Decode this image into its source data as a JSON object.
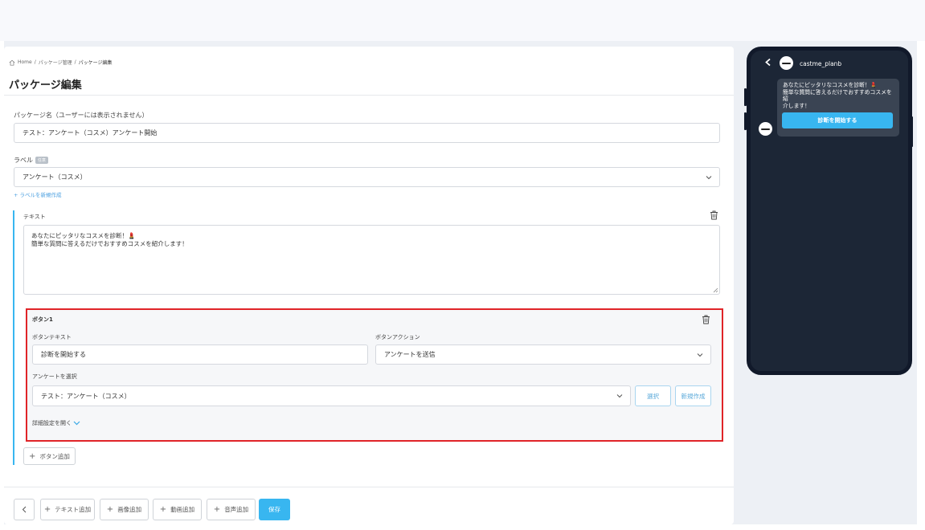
{
  "breadcrumb": {
    "home": "Home",
    "sep1": "/",
    "item1": "パッケージ管理",
    "sep2": "/",
    "item2": "パッケージ編集"
  },
  "page_title": "パッケージ編集",
  "package_name": {
    "label": "パッケージ名（ユーザーには表示されません）",
    "value": "テスト：アンケート（コスメ）アンケート開始"
  },
  "label_field": {
    "label": "ラベル",
    "badge": "任意",
    "value": "アンケート（コスメ）",
    "create_link": "+ ラベルを新規作成"
  },
  "text_block": {
    "title": "テキスト",
    "line1": "あなたにピッタリなコスメを診断！",
    "line1_emoji": "💄",
    "line2": "簡単な質問に答えるだけでおすすめコスメを紹介します！"
  },
  "button_card": {
    "title": "ボタン1",
    "button_text_label": "ボタンテキスト",
    "button_text_value": "診断を開始する",
    "button_action_label": "ボタンアクション",
    "button_action_value": "アンケートを送信",
    "survey_label": "アンケートを選択",
    "survey_value": "テスト：アンケート（コスメ）",
    "select_button": "選択",
    "new_button": "新規作成",
    "details_link": "詳細設定を開く"
  },
  "add_button": "ボタン追加",
  "footer": {
    "back": "<",
    "add_text": "テキスト追加",
    "add_image": "画像追加",
    "add_video": "動画追加",
    "add_audio": "音声追加",
    "save": "保存"
  },
  "preview": {
    "account_name": "castme_planb",
    "message_line1": "あなたにピッタリなコスメを診断！",
    "message_emoji": "💄",
    "message_line2": "簡単な質問に答えるだけでおすすめコスメを紹",
    "message_line3": "介します！",
    "button_label": "診断を開始する"
  },
  "colors": {
    "accent": "#38b6f0",
    "highlight": "#e02428",
    "phone_bg": "#1c2636"
  }
}
